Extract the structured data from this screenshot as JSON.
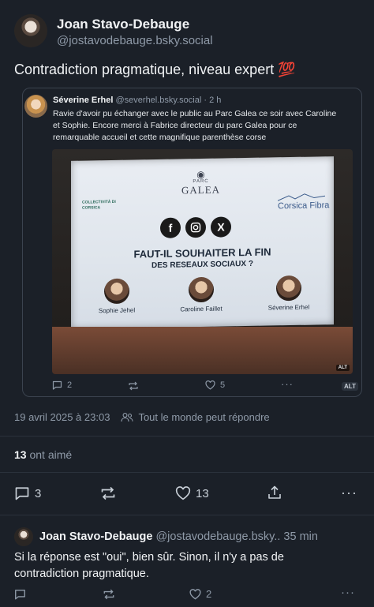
{
  "post": {
    "author_name": "Joan Stavo-Debauge",
    "handle": "@jostavodebauge.bsky.social",
    "text": "Contradiction pragmatique, niveau expert",
    "emoji": "💯",
    "date": "19 avril 2025 à 23:03",
    "reply_setting": "Tout le monde peut répondre",
    "likes_count": "13",
    "likes_label": "ont aimé",
    "actions": {
      "replies": "3",
      "likes": "13"
    }
  },
  "quoted": {
    "author_name": "Séverine Erhel",
    "handle": "@severhel.bsky.social",
    "time": "· 2 h",
    "text": "Ravie d'avoir pu échanger avec le public au Parc Galea ce soir avec Caroline et Sophie. Encore merci à Fabrice directeur du parc Galea pour ce remarquable accueil et cette magnifique parenthèse corse",
    "image_alt_badge": "ALT",
    "actions": {
      "replies": "2",
      "likes": "5",
      "alt": "ALT"
    },
    "slide": {
      "logo_top": "PARC",
      "logo_name": "GALEA",
      "sponsor": "Corsica Fibra",
      "left_logo": "COLLECTIVITÀ DI CORSICA",
      "social_icons": [
        "facebook-icon",
        "instagram-icon",
        "x-icon"
      ],
      "title": "FAUT-IL SOUHAITER LA FIN",
      "subtitle": "DES RESEAUX SOCIAUX ?",
      "speakers": [
        "Sophie Jehel",
        "Caroline Faillet",
        "Séverine Erhel"
      ]
    }
  },
  "reply": {
    "author_name": "Joan Stavo-Debauge",
    "handle": "@jostavodebauge.bsky..",
    "time": "35 min",
    "text": "Si la réponse est \"oui\", bien sûr. Sinon, il n'y a pas de contradiction pragmatique.",
    "actions": {
      "likes": "2"
    }
  },
  "colors": {
    "background": "#1b2028",
    "muted": "#8f9aa8",
    "border": "#3b434f"
  }
}
